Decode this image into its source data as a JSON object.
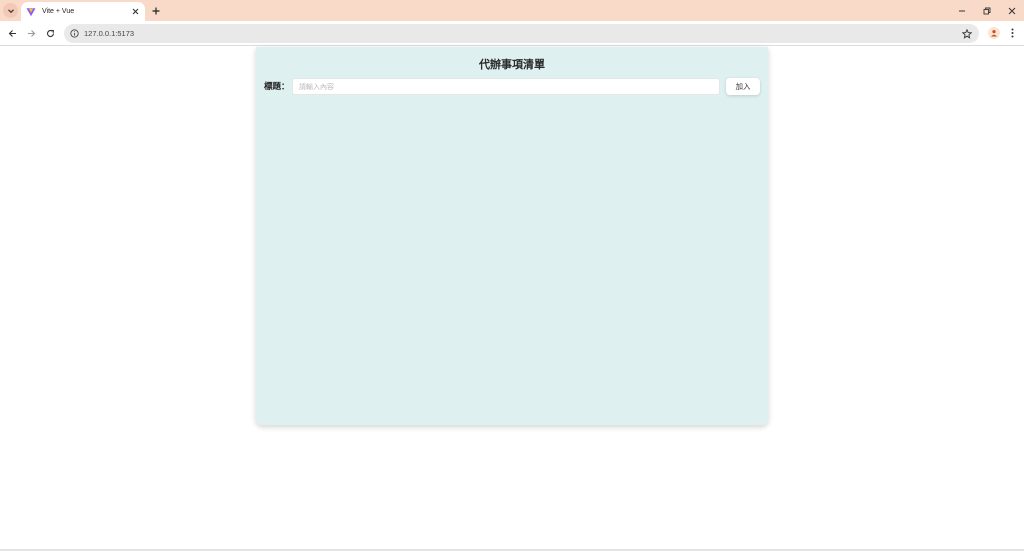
{
  "browser": {
    "tab": {
      "title": "Vite + Vue"
    },
    "address_bar": {
      "url": "127.0.0.1:5173"
    },
    "colors": {
      "tabbar_bg": "#f9d9c8",
      "omnibox_bg": "#e9e9e9"
    }
  },
  "app": {
    "title": "代辦事項清單",
    "form": {
      "label": "標題：",
      "input_value": "",
      "input_placeholder": "請輸入內容",
      "add_button_label": "加入"
    },
    "colors": {
      "card_bg": "#dff0f0"
    }
  }
}
